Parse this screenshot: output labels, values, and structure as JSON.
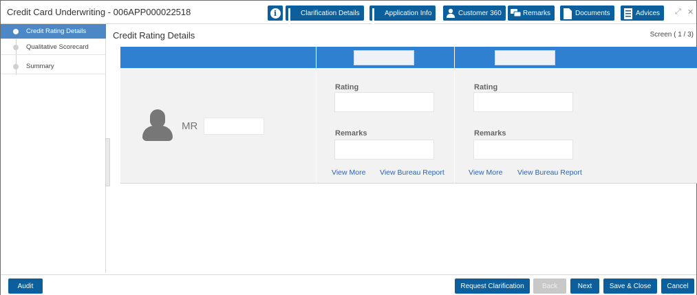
{
  "header": {
    "title": "Credit Card Underwriting - 006APP000022518",
    "toolbar": [
      {
        "label": "",
        "icon": "info-icon"
      },
      {
        "label": "Clarification Details",
        "icon": "library-icon"
      },
      {
        "label": "Application Info",
        "icon": "library-icon"
      },
      {
        "label": "Customer 360",
        "icon": "customer-icon"
      },
      {
        "label": "Remarks",
        "icon": "chat-icon"
      },
      {
        "label": "Documents",
        "icon": "document-icon"
      },
      {
        "label": "Advices",
        "icon": "advice-icon"
      }
    ]
  },
  "sidebar": {
    "items": [
      {
        "label": "Credit Rating Details",
        "active": true
      },
      {
        "label": "Qualitative Scorecard",
        "active": false
      },
      {
        "label": "Summary",
        "active": false
      }
    ]
  },
  "main": {
    "title": "Credit Rating Details",
    "screen": "Screen ( 1 / 3)",
    "applicant": {
      "salutation": "MR"
    },
    "bureaus": [
      {
        "rating_label": "Rating",
        "remarks_label": "Remarks",
        "view_more": "View More",
        "view_report": "View Bureau Report"
      },
      {
        "rating_label": "Rating",
        "remarks_label": "Remarks",
        "view_more": "View More",
        "view_report": "View Bureau Report"
      }
    ]
  },
  "footer": {
    "audit": "Audit",
    "request_clarification": "Request Clarification",
    "back": "Back",
    "next": "Next",
    "save_close": "Save & Close",
    "cancel": "Cancel"
  },
  "colors": {
    "toolbar_button": "#0a5f9c",
    "panel_header": "#2f80d1",
    "sidebar_active": "#4c88c5",
    "link": "#2a64b3"
  }
}
